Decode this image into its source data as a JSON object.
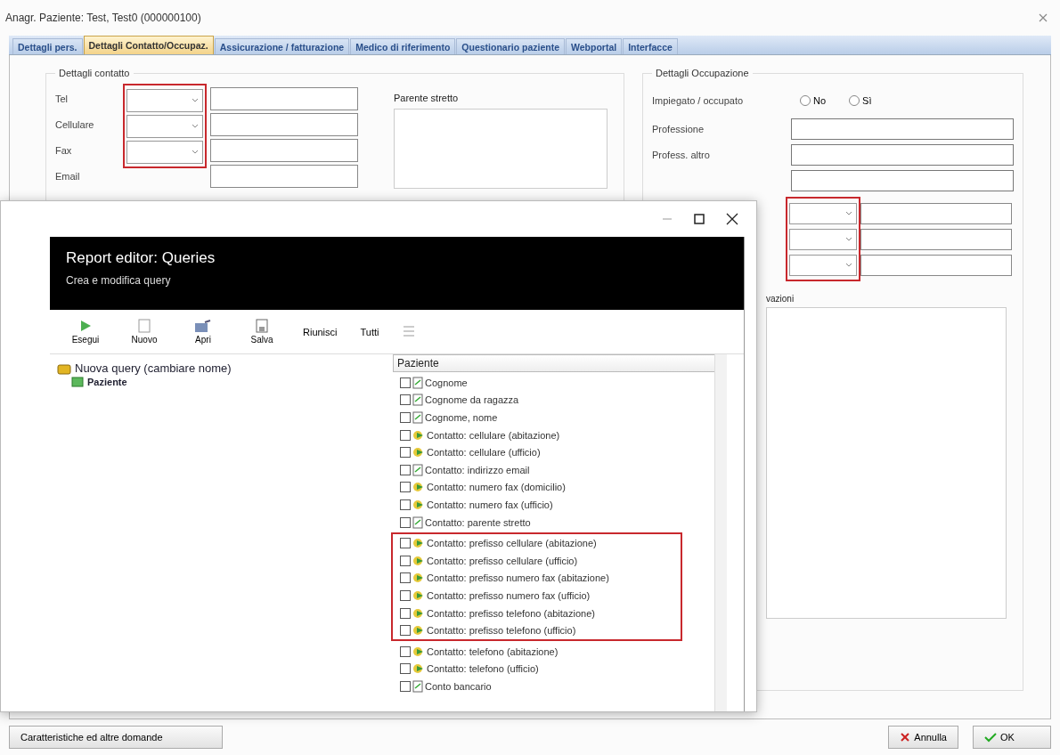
{
  "window": {
    "title": "Anagr. Paziente: Test, Test0 (000000100)"
  },
  "tabs": [
    {
      "label": "Dettagli pers.",
      "selected": false
    },
    {
      "label": "Dettagli Contatto/Occupaz.",
      "selected": true
    },
    {
      "label": "Assicurazione / fatturazione",
      "selected": false
    },
    {
      "label": "Medico di riferimento",
      "selected": false
    },
    {
      "label": "Questionario paziente",
      "selected": false
    },
    {
      "label": "Webportal",
      "selected": false
    },
    {
      "label": "Interfacce",
      "selected": false
    }
  ],
  "contact": {
    "title": "Dettagli contatto",
    "highlighted": true,
    "rows": [
      {
        "label": "Tel"
      },
      {
        "label": "Cellulare"
      },
      {
        "label": "Fax"
      },
      {
        "label": "Email"
      }
    ],
    "relative_label": "Parente stretto"
  },
  "occupation": {
    "title": "Dettagli Occupazione",
    "employed_label": "Impiegato / occupato",
    "options": [
      {
        "label": "No",
        "selected": false
      },
      {
        "label": "Sì",
        "selected": false
      }
    ],
    "fields": [
      {
        "label": "Professione"
      },
      {
        "label": "Profess. altro"
      }
    ],
    "combos_highlighted": true,
    "notes_label": "vazioni"
  },
  "buttons": {
    "extra": "Caratteristiche ed altre domande",
    "cancel": "Annulla",
    "ok": "OK"
  },
  "editor": {
    "title": "Report editor: Queries",
    "subtitle": "Crea e modifica query",
    "toolbar": [
      {
        "label": "Esegui",
        "kind": "run"
      },
      {
        "label": "Nuovo",
        "kind": "new"
      },
      {
        "label": "Apri",
        "kind": "open"
      },
      {
        "label": "Salva",
        "kind": "save"
      }
    ],
    "toolbar_text": [
      {
        "label": "Riunisci"
      },
      {
        "label": "Tutti"
      }
    ],
    "tree": {
      "label": "Nuova query (cambiare nome)",
      "children": [
        {
          "label": "Paziente"
        }
      ]
    },
    "fields_header": "Paziente",
    "sections": [
      {
        "highlighted": false,
        "items": [
          {
            "label": "Cognome",
            "kind": "field",
            "checked": false
          },
          {
            "label": "Cognome da ragazza",
            "kind": "field",
            "checked": false
          },
          {
            "label": "Cognome, nome",
            "kind": "field",
            "checked": false
          },
          {
            "label": "Contatto: cellulare (abitazione)",
            "kind": "link",
            "checked": false
          },
          {
            "label": "Contatto: cellulare (ufficio)",
            "kind": "link",
            "checked": false
          },
          {
            "label": "Contatto: indirizzo email",
            "kind": "field",
            "checked": false
          },
          {
            "label": "Contatto: numero fax (domicilio)",
            "kind": "link",
            "checked": false
          },
          {
            "label": "Contatto: numero fax (ufficio)",
            "kind": "link",
            "checked": false
          },
          {
            "label": "Contatto: parente stretto",
            "kind": "field",
            "checked": false
          }
        ]
      },
      {
        "highlighted": true,
        "items": [
          {
            "label": "Contatto: prefisso cellulare (abitazione)",
            "kind": "link",
            "checked": false
          },
          {
            "label": "Contatto: prefisso cellulare (ufficio)",
            "kind": "link",
            "checked": false
          },
          {
            "label": "Contatto: prefisso numero fax (abitazione)",
            "kind": "link",
            "checked": false
          },
          {
            "label": "Contatto: prefisso numero fax (ufficio)",
            "kind": "link",
            "checked": false
          },
          {
            "label": "Contatto: prefisso telefono (abitazione)",
            "kind": "link",
            "checked": false
          },
          {
            "label": "Contatto: prefisso telefono (ufficio)",
            "kind": "link",
            "checked": false
          }
        ]
      },
      {
        "highlighted": false,
        "items": [
          {
            "label": "Contatto: telefono (abitazione)",
            "kind": "link",
            "checked": false
          },
          {
            "label": "Contatto: telefono (ufficio)",
            "kind": "link",
            "checked": false
          },
          {
            "label": "Conto bancario",
            "kind": "field",
            "checked": false
          }
        ]
      }
    ]
  }
}
